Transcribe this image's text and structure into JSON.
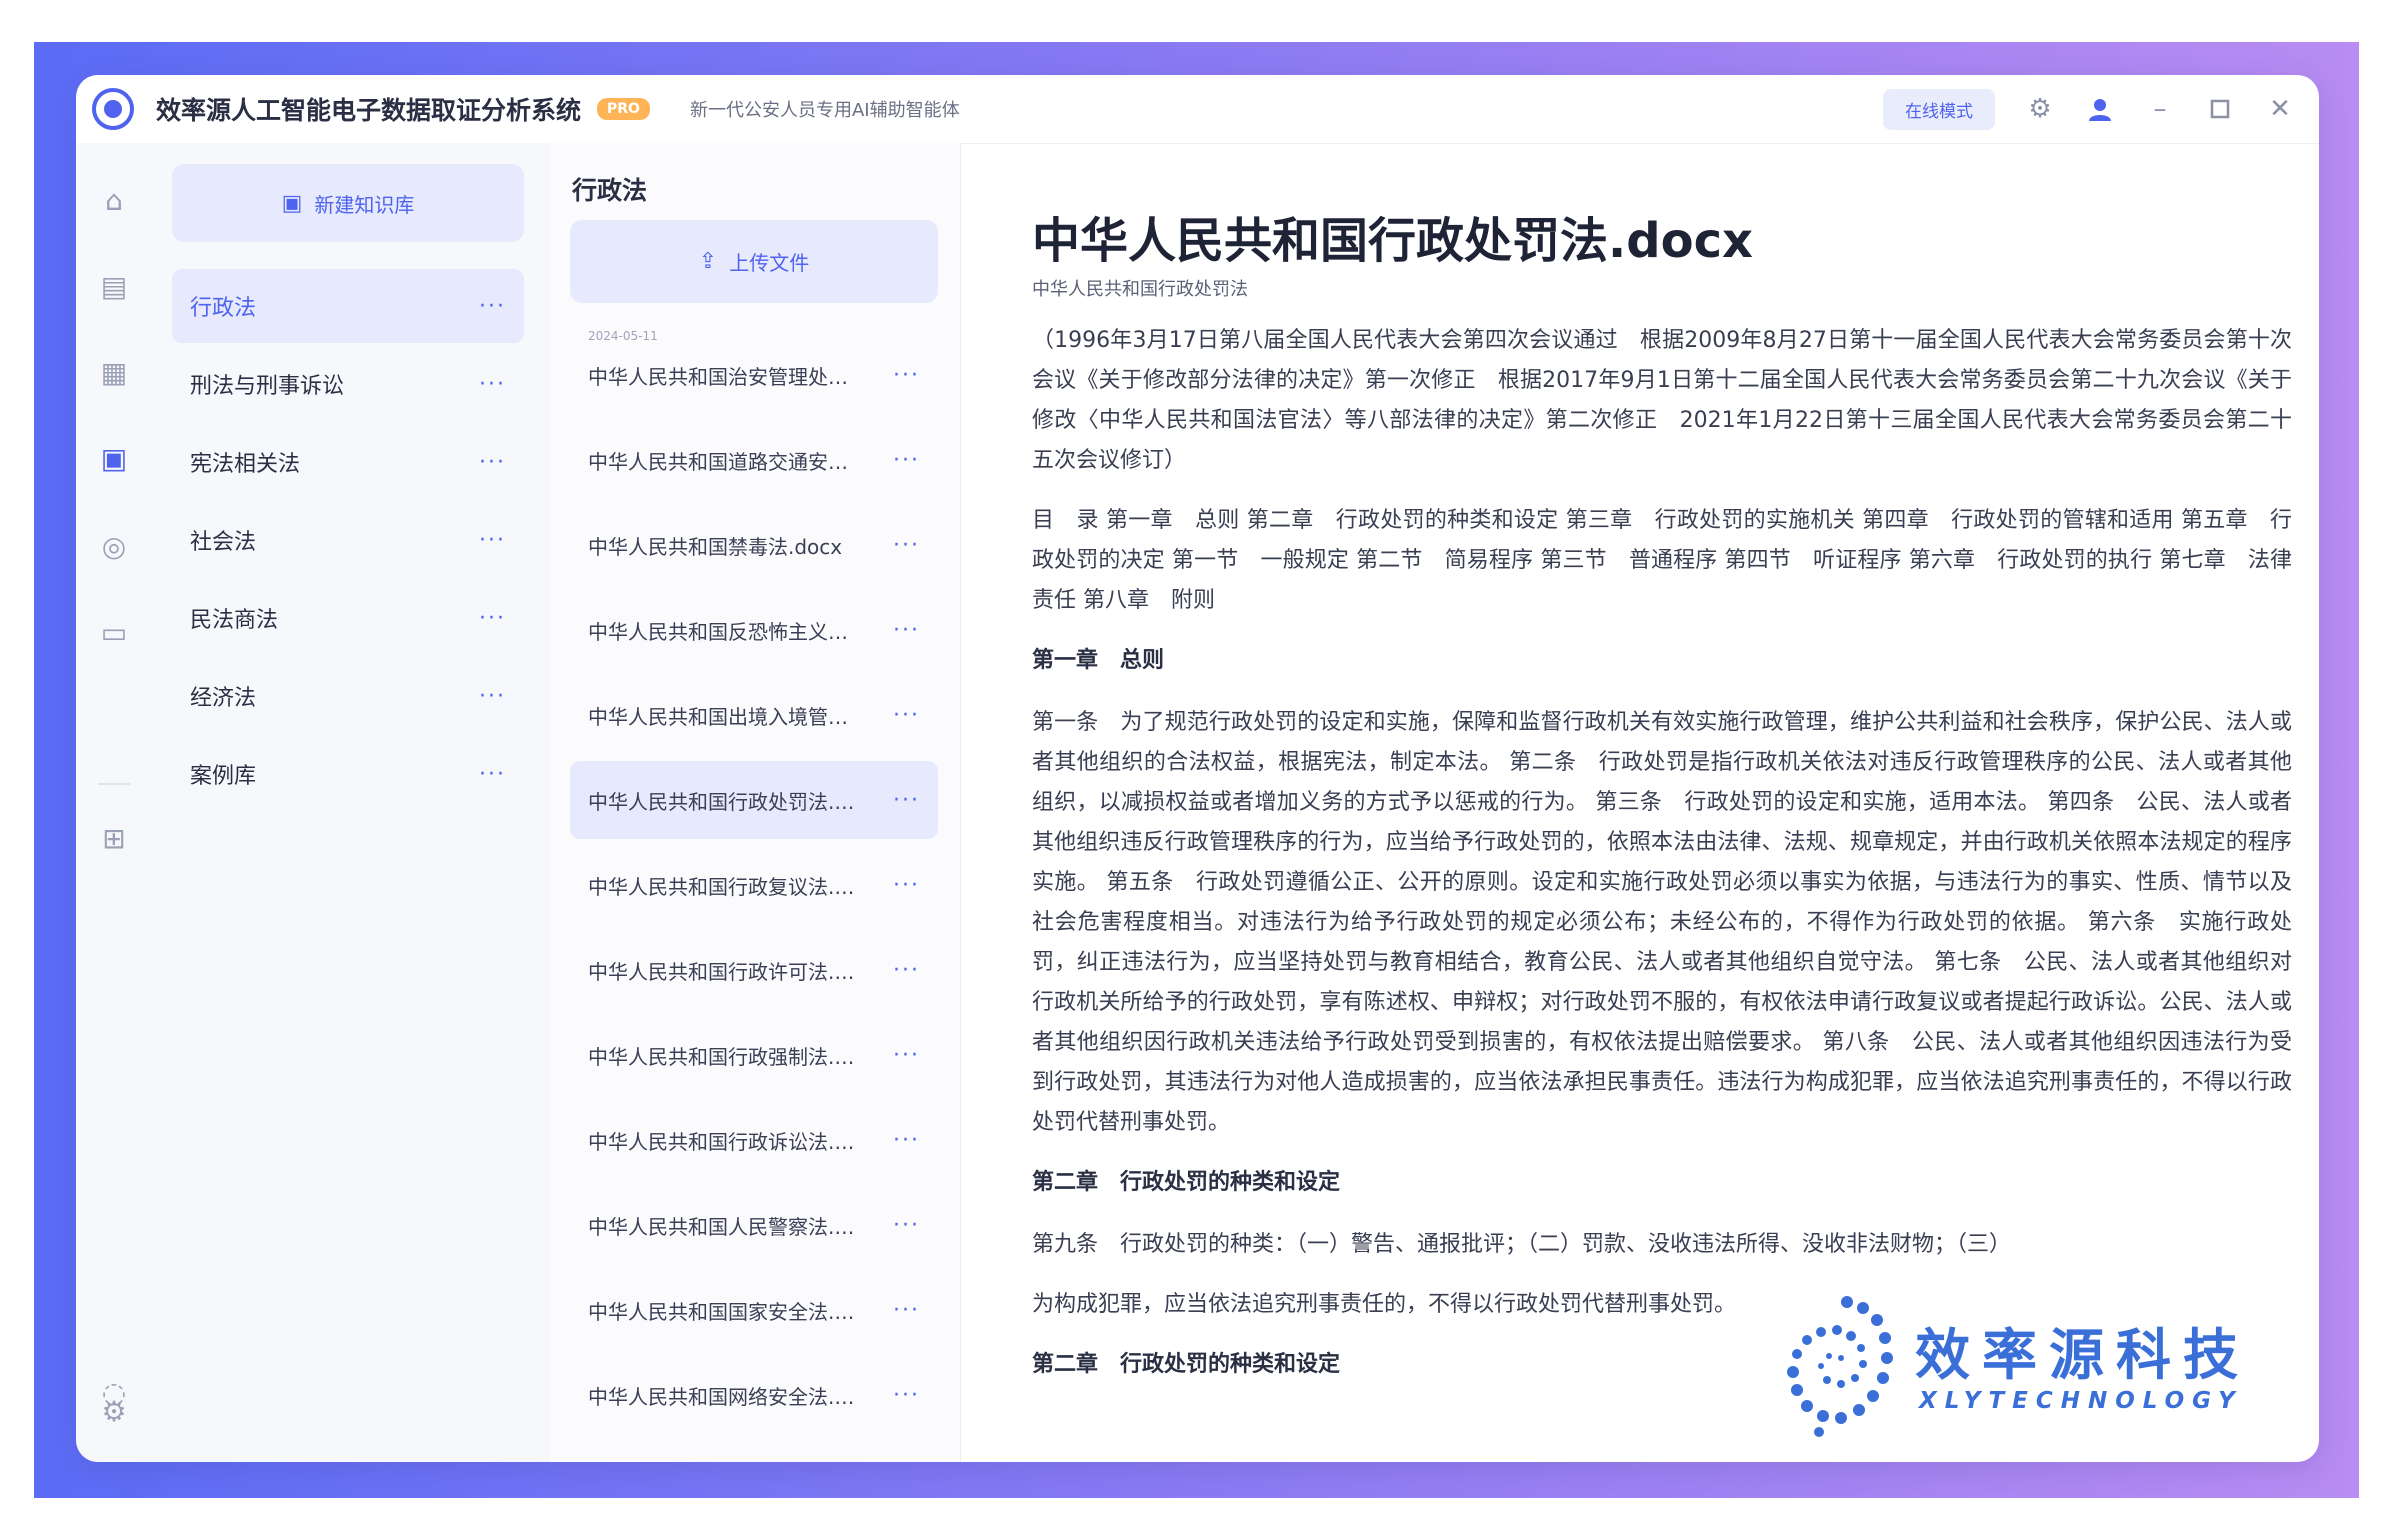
{
  "app": {
    "title": "效率源人工智能电子数据取证分析系统",
    "badge": "PRO",
    "subtitle": "新一代公安人员专用AI辅助智能体",
    "top_button": "在线模式"
  },
  "categories_panel": {
    "new_button": "新建知识库",
    "items": [
      {
        "label": "行政法"
      },
      {
        "label": "刑法与刑事诉讼"
      },
      {
        "label": "宪法相关法"
      },
      {
        "label": "社会法"
      },
      {
        "label": "民法商法"
      },
      {
        "label": "经济法"
      },
      {
        "label": "案例库"
      }
    ]
  },
  "files_panel": {
    "title": "行政法",
    "upload_button": "上传文件",
    "date_label": "2024-05-11",
    "files": [
      {
        "name": "中华人民共和国治安管理处罚法.docx"
      },
      {
        "name": "中华人民共和国道路交通安全法.docx"
      },
      {
        "name": "中华人民共和国禁毒法.docx"
      },
      {
        "name": "中华人民共和国反恐怖主义法.docx"
      },
      {
        "name": "中华人民共和国出境入境管理法.docx"
      },
      {
        "name": "中华人民共和国行政处罚法.docx"
      },
      {
        "name": "中华人民共和国行政复议法.docx"
      },
      {
        "name": "中华人民共和国行政许可法.docx"
      },
      {
        "name": "中华人民共和国行政强制法.docx"
      },
      {
        "name": "中华人民共和国行政诉讼法.docx"
      },
      {
        "name": "中华人民共和国人民警察法.docx"
      },
      {
        "name": "中华人民共和国国家安全法.docx"
      },
      {
        "name": "中华人民共和国网络安全法.docx"
      }
    ]
  },
  "document": {
    "title": "中华人民共和国行政处罚法.docx",
    "subtitle": "中华人民共和国行政处罚法",
    "paragraphs": [
      {
        "text": "（1996年3月17日第八届全国人民代表大会第四次会议通过　根据2009年8月27日第十一届全国人民代表大会常务委员会第十次会议《关于修改部分法律的决定》第一次修正　根据2017年9月1日第十二届全国人民代表大会常务委员会第二十九次会议《关于修改〈中华人民共和国法官法〉等八部法律的决定》第二次修正　2021年1月22日第十三届全国人民代表大会常务委员会第二十五次会议修订）",
        "heading": false
      },
      {
        "text": "目　录 第一章　总则 第二章　行政处罚的种类和设定 第三章　行政处罚的实施机关 第四章　行政处罚的管辖和适用 第五章　行政处罚的决定 第一节　一般规定 第二节　简易程序 第三节　普通程序 第四节　听证程序 第六章　行政处罚的执行 第七章　法律责任 第八章　附则",
        "heading": false
      },
      {
        "text": "第一章　总则",
        "heading": true
      },
      {
        "text": "第一条　为了规范行政处罚的设定和实施，保障和监督行政机关有效实施行政管理，维护公共利益和社会秩序，保护公民、法人或者其他组织的合法权益，根据宪法，制定本法。 第二条　行政处罚是指行政机关依法对违反行政管理秩序的公民、法人或者其他组织，以减损权益或者增加义务的方式予以惩戒的行为。 第三条　行政处罚的设定和实施，适用本法。 第四条　公民、法人或者其他组织违反行政管理秩序的行为，应当给予行政处罚的，依照本法由法律、法规、规章规定，并由行政机关依照本法规定的程序实施。 第五条　行政处罚遵循公正、公开的原则。设定和实施行政处罚必须以事实为依据，与违法行为的事实、性质、情节以及社会危害程度相当。对违法行为给予行政处罚的规定必须公布；未经公布的，不得作为行政处罚的依据。 第六条　实施行政处罚，纠正违法行为，应当坚持处罚与教育相结合，教育公民、法人或者其他组织自觉守法。 第七条　公民、法人或者其他组织对行政机关所给予的行政处罚，享有陈述权、申辩权；对行政处罚不服的，有权依法申请行政复议或者提起行政诉讼。公民、法人或者其他组织因行政机关违法给予行政处罚受到损害的，有权依法提出赔偿要求。 第八条　公民、法人或者其他组织因违法行为受到行政处罚，其违法行为对他人造成损害的，应当依法承担民事责任。违法行为构成犯罪，应当依法追究刑事责任的，不得以行政处罚代替刑事处罚。",
        "heading": false
      },
      {
        "text": "第二章　行政处罚的种类和设定",
        "heading": true
      },
      {
        "text": "第九条　行政处罚的种类：（一）警告、通报批评；（二）罚款、没收违法所得、没收非法财物；（三）",
        "heading": false
      },
      {
        "text": "为构成犯罪，应当依法追究刑事责任的，不得以行政处罚代替刑事处罚。",
        "heading": false
      },
      {
        "text": "第二章　行政处罚的种类和设定",
        "heading": true
      }
    ]
  },
  "watermark": {
    "name_cn": "效率源科技",
    "name_en": "XLYTECHNOLOGY",
    "color": "#3b6fd8"
  },
  "colors": {
    "accent": "#4f63ee",
    "frame_gradient": [
      "#5b6cf5",
      "#b88cf2"
    ],
    "selected_bg": "#e6eafc"
  }
}
